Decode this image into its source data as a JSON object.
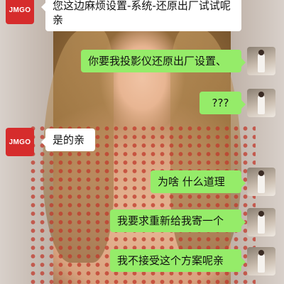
{
  "chat": {
    "contact_avatar_text": "JMGO",
    "messages": [
      {
        "from": "contact",
        "text": "您这边麻烦设置-系统-还原出厂试试呢亲"
      },
      {
        "from": "me",
        "text": "你要我投影仪还原出厂设置、"
      },
      {
        "from": "me",
        "text": "???"
      },
      {
        "from": "contact",
        "text": "是的亲"
      },
      {
        "from": "me",
        "text": "为啥 什么道理"
      },
      {
        "from": "me",
        "text": "我要求重新给我寄一个"
      },
      {
        "from": "me",
        "text": "我不接受这个方案呢亲"
      }
    ]
  },
  "colors": {
    "outgoing_bubble": "#95ec69",
    "incoming_bubble": "#ffffff",
    "brand_red": "#d62c2c"
  }
}
